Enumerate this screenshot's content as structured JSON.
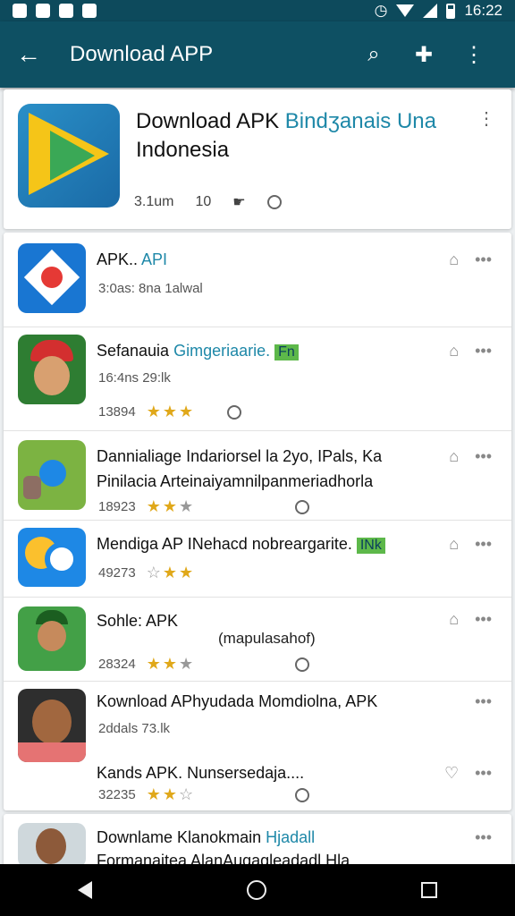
{
  "status": {
    "time": "16:22"
  },
  "appbar": {
    "title": "Download APP",
    "back_icon": "arrow-left-icon",
    "search_icon": "search-icon",
    "pin_icon": "pin-icon",
    "more_icon": "more-vert-icon"
  },
  "featured": {
    "title_main": "Download APK ",
    "title_accent": "Bindʒanais Una",
    "title_line2": "Indonesia",
    "meta_size": "3.1um",
    "meta_count": "10"
  },
  "items": [
    {
      "title": "APK.. ",
      "title_accent": "API",
      "sub": "3:0as:  8na     1alwal",
      "stars": ""
    },
    {
      "title": "Sefanauia ",
      "title_accent": "Gimgeriaarie.",
      "badge": "Fn",
      "sub": "16:4ns  29:lk",
      "meta": "13894",
      "stars_on": "★★★",
      "stars_off": ""
    },
    {
      "title": "Dannialiage Indariorsel la 2yo, IPals, Ka",
      "title2": "Pinilacia Arteinaiyamnilpanmeriadhorla",
      "meta": "18923",
      "stars_on": "★★",
      "stars_off": "★"
    },
    {
      "title": "Mendiga AP INehacd nobreargarite. ",
      "badge": "INk",
      "meta": "49273",
      "stars_on": "★★",
      "stars_off": "☆"
    },
    {
      "title": "Sohle: APK",
      "sub2": "(mapulasahof)",
      "meta": "28324",
      "stars_on": "★★",
      "stars_off": "★"
    },
    {
      "title": "Kownload APhyudada Momdiolna, APK",
      "sub": "2ddals  73.lk",
      "title2": "Kands APK. Nunsersedaja....",
      "meta": "32235",
      "stars_on": "★★",
      "stars_off": "☆"
    },
    {
      "title": "Downlame ",
      "title_accent": "Hjadall",
      "title_mid": "Klanokmain ",
      "title2": "Formanaitea AlanAugagleadadl.Hla"
    }
  ]
}
